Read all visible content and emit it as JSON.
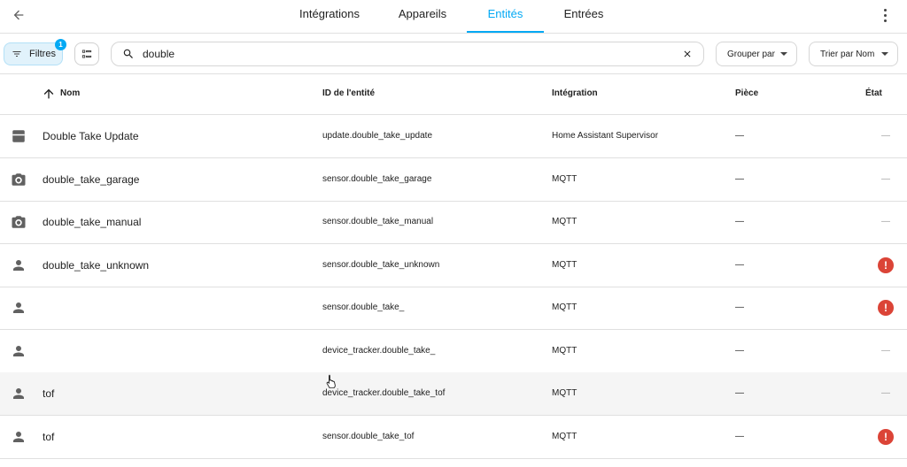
{
  "tabs": [
    {
      "label": "Intégrations",
      "active": false
    },
    {
      "label": "Appareils",
      "active": false
    },
    {
      "label": "Entités",
      "active": true
    },
    {
      "label": "Entrées",
      "active": false
    }
  ],
  "filters": {
    "label": "Filtres",
    "badge_count": "1"
  },
  "search": {
    "value": "double"
  },
  "group_by": {
    "label": "Grouper par"
  },
  "sort_by": {
    "label": "Trier par Nom"
  },
  "columns": {
    "name": "Nom",
    "entity_id": "ID de l'entité",
    "integration": "Intégration",
    "area": "Pièce",
    "state": "État"
  },
  "rows": [
    {
      "icon": "update-icon",
      "name": "Double Take Update",
      "entity_id": "update.double_take_update",
      "integration": "Home Assistant Supervisor",
      "area": "—",
      "state": "—",
      "status": "ok"
    },
    {
      "icon": "camera-icon",
      "name": "double_take_garage",
      "entity_id": "sensor.double_take_garage",
      "integration": "MQTT",
      "area": "—",
      "state": "—",
      "status": "ok"
    },
    {
      "icon": "camera-icon",
      "name": "double_take_manual",
      "entity_id": "sensor.double_take_manual",
      "integration": "MQTT",
      "area": "—",
      "state": "—",
      "status": "ok"
    },
    {
      "icon": "person-icon",
      "name": "double_take_unknown",
      "entity_id": "sensor.double_take_unknown",
      "integration": "MQTT",
      "area": "—",
      "state": "!",
      "status": "error"
    },
    {
      "icon": "person-icon",
      "name": "",
      "entity_id": "sensor.double_take_",
      "integration": "MQTT",
      "area": "—",
      "state": "!",
      "status": "error"
    },
    {
      "icon": "person-icon",
      "name": "",
      "entity_id": "device_tracker.double_take_",
      "integration": "MQTT",
      "area": "—",
      "state": "—",
      "status": "ok"
    },
    {
      "icon": "person-icon",
      "name": "tof",
      "entity_id": "device_tracker.double_take_tof",
      "integration": "MQTT",
      "area": "—",
      "state": "—",
      "status": "ok"
    },
    {
      "icon": "person-icon",
      "name": "tof",
      "entity_id": "sensor.double_take_tof",
      "integration": "MQTT",
      "area": "—",
      "state": "!",
      "status": "error"
    }
  ],
  "colors": {
    "accent": "#03a9f4",
    "error": "#db4437",
    "icon": "#616161"
  }
}
